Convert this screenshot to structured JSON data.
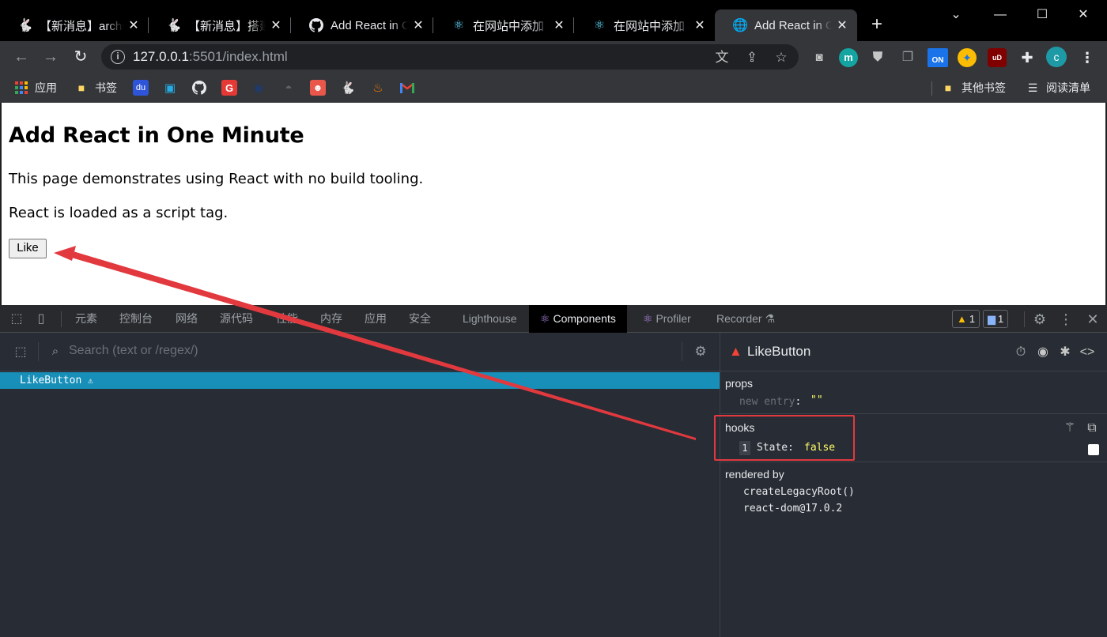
{
  "tabs": [
    {
      "title": "【新消息】archi",
      "icon": "rabbit-icon"
    },
    {
      "title": "【新消息】搭建",
      "icon": "rabbit-icon"
    },
    {
      "title": "Add React in O",
      "icon": "github-icon"
    },
    {
      "title": "在网站中添加 Re",
      "icon": "react-icon"
    },
    {
      "title": "在网站中添加 Re",
      "icon": "react-icon"
    },
    {
      "title": "Add React in O",
      "icon": "globe-icon",
      "active": true
    }
  ],
  "omnibox": {
    "url_host": "127.0.0.1",
    "url_rest": ":5501/index.html"
  },
  "extensions": {
    "m_label": "m",
    "on_label": "ON",
    "ub_label": "uD",
    "profile_label": "c"
  },
  "bookmarks": {
    "apps": "应用",
    "bookmarks": "书签",
    "other": "其他书签",
    "reading": "阅读清单"
  },
  "page": {
    "heading": "Add React in One Minute",
    "para1": "This page demonstrates using React with no build tooling.",
    "para2": "React is loaded as a script tag.",
    "button": "Like"
  },
  "devtools": {
    "tabs": [
      "元素",
      "控制台",
      "网络",
      "源代码",
      "性能",
      "内存",
      "应用",
      "安全",
      "Lighthouse",
      "Components",
      "Profiler",
      "Recorder"
    ],
    "active_tab": "Components",
    "warnings_count": "1",
    "messages_count": "1",
    "search_placeholder": "Search (text or /regex/)",
    "tree_item": "LikeButton",
    "inspector": {
      "component": "LikeButton",
      "props_label": "props",
      "new_entry_key": "new entry",
      "new_entry_value": "\"\"",
      "hooks_label": "hooks",
      "hook_index": "1",
      "hook_name": "State:",
      "hook_value": "false",
      "rendered_by_label": "rendered by",
      "rendered_by": [
        "createLegacyRoot()",
        "react-dom@17.0.2"
      ]
    }
  },
  "colors": {
    "annotation": "#e2393f",
    "selected_row": "#178fb9",
    "hook_value": "#ffff66"
  }
}
